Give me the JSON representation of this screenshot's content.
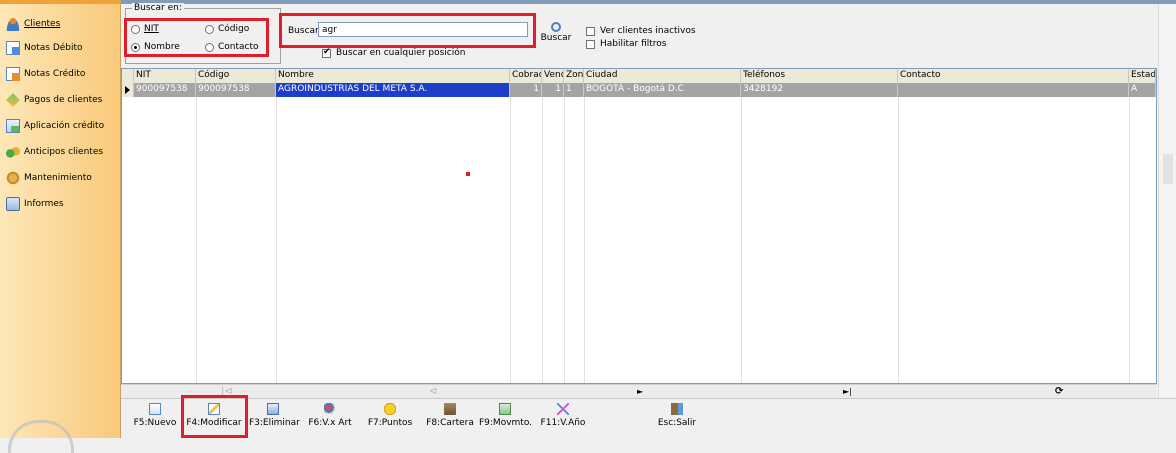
{
  "sidebar": {
    "items": [
      {
        "label": "Clientes",
        "icon": "user-icon"
      },
      {
        "label": "Notas Débito",
        "icon": "document-blue-icon"
      },
      {
        "label": "Notas Crédito",
        "icon": "document-orange-icon"
      },
      {
        "label": "Pagos de clientes",
        "icon": "diamond-icon"
      },
      {
        "label": "Aplicación crédito",
        "icon": "sheet-icon"
      },
      {
        "label": "Anticipos clientes",
        "icon": "people-icon"
      },
      {
        "label": "Mantenimiento",
        "icon": "tools-icon"
      },
      {
        "label": "Informes",
        "icon": "printer-icon"
      }
    ]
  },
  "search": {
    "group_label": "Buscar en:",
    "options": [
      {
        "label": "NIT",
        "selected": false
      },
      {
        "label": "Código",
        "selected": false
      },
      {
        "label": "Nombre",
        "selected": true
      },
      {
        "label": "Contacto",
        "selected": false
      }
    ],
    "field_label": "Buscar:",
    "value": "agr",
    "button_label": "Buscar",
    "any_position_label": "Buscar en cualquier posición",
    "any_position_checked": true,
    "inactive_label": "Ver clientes inactivos",
    "inactive_checked": false,
    "filters_label": "Habilitar filtros",
    "filters_checked": false
  },
  "grid": {
    "columns": [
      "NIT",
      "Código",
      "Nombre",
      "Cobrad",
      "Vend",
      "Zon",
      "Ciudad",
      "Teléfonos",
      "Contacto",
      "Estad"
    ],
    "rows": [
      [
        "900097538",
        "900097538",
        "AGROINDUSTRIAS DEL META S.A.",
        "1",
        "1",
        "1",
        "BOGOTÁ - Bogotá D.C",
        "3428192",
        "",
        "A"
      ]
    ]
  },
  "navbar": {
    "first": "|⊲",
    "prev": "⊲",
    "next": "►",
    "last": "►|",
    "refresh": "⟳"
  },
  "toolbar": {
    "buttons": [
      {
        "label": "F5:Nuevo",
        "icon": "new-icon"
      },
      {
        "label": "F4:Modificar",
        "icon": "edit-icon"
      },
      {
        "label": "F3:Eliminar",
        "icon": "delete-icon"
      },
      {
        "label": "F6:V.x Art",
        "icon": "articles-icon"
      },
      {
        "label": "F7:Puntos",
        "icon": "points-icon"
      },
      {
        "label": "F8:Cartera",
        "icon": "portfolio-icon"
      },
      {
        "label": "F9:Movmto.",
        "icon": "movement-icon"
      },
      {
        "label": "F11:V.Año",
        "icon": "year-chart-icon"
      },
      {
        "label": "Esc:Salir",
        "icon": "exit-icon"
      }
    ]
  },
  "colors": {
    "highlight_box": "#e01e2a",
    "selected_cell": "#1c3ec9",
    "selected_row": "#a4a4a4",
    "sidebar_gradient_start": "#fde7b8",
    "sidebar_gradient_end": "#f9c97a"
  }
}
